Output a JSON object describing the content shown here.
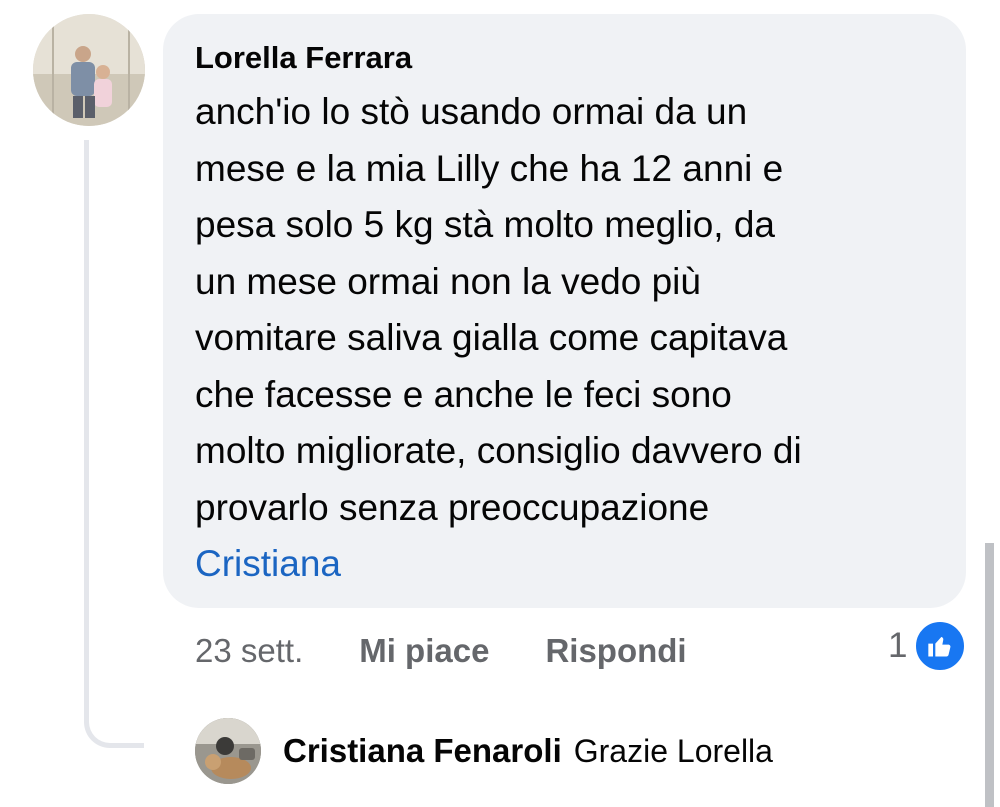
{
  "comment": {
    "author": "Lorella Ferrara",
    "text": "anch'io lo stò usando ormai da un\nmese e la mia Lilly che ha 12 anni e\npesa solo 5 kg stà molto meglio, da\nun mese ormai non la vedo più\nvomitare saliva gialla come capitava\nche facesse e anche le feci sono\nmolto migliorate, consiglio davvero di\nprovarlo senza preoccupazione",
    "mention": "Cristiana",
    "timestamp": "23 sett.",
    "like_label": "Mi piace",
    "reply_label": "Rispondi",
    "reaction_count": "1",
    "reaction_icon": "thumbs-up-icon",
    "reaction_color": "#1877f2",
    "mention_color": "#1b65c2"
  },
  "reply": {
    "author": "Cristiana Fenaroli",
    "text": "Grazie Lorella"
  }
}
